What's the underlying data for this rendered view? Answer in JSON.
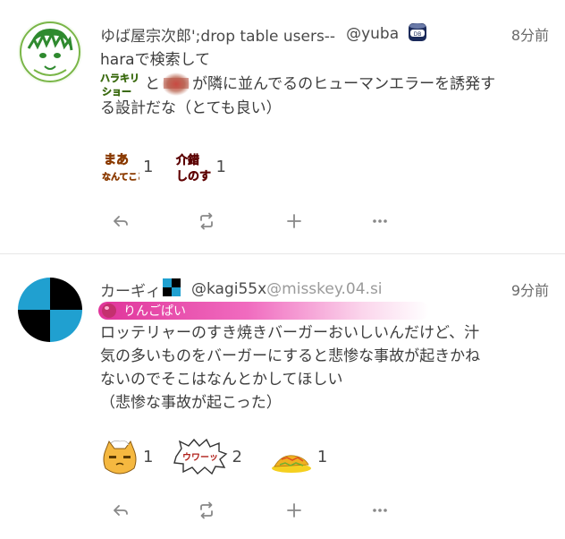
{
  "notes": [
    {
      "display_name": "ゆば屋宗次郎';drop table users--",
      "username": "@yuba",
      "time": "8分前",
      "name_emoji": "database-can-emoji",
      "text_line1": "haraで検索して",
      "emoji_harakiri_text": "ハラキリショー",
      "text_to": "と",
      "text_line2_rest": "が隣に並んでるのヒューマンエラーを誘発す",
      "text_line3": "る設計だな（とても良い）",
      "reactions": [
        {
          "emoji_text": "まあなんてこと",
          "count": "1"
        },
        {
          "emoji_text": "介錯しのす",
          "count": "1"
        }
      ]
    },
    {
      "display_name": "カーギィ",
      "username": "@kagi55x",
      "host": "@misskey.04.si",
      "time": "9分前",
      "role": "りんごぱい",
      "text_lines": [
        "ロッテリャーのすき焼きバーガーおいしいんだけど、汁",
        "気の多いものをバーガーにすると悲惨な事故が起きかね",
        "ないのでそこはなんとかしてほしい",
        "（悲惨な事故が起こった）"
      ],
      "reactions": [
        {
          "emoji_text": "",
          "count": "1"
        },
        {
          "emoji_text": "ウワーッ",
          "count": "2"
        },
        {
          "emoji_text": "",
          "count": "1"
        }
      ]
    }
  ],
  "colors": {
    "text": "#3d3d3d",
    "muted": "#9a9a9a",
    "role_gradient_start": "#e0349a",
    "divider": "#e6e6e6"
  },
  "icons": [
    "reply-icon",
    "renote-icon",
    "plus-icon",
    "more-icon"
  ]
}
